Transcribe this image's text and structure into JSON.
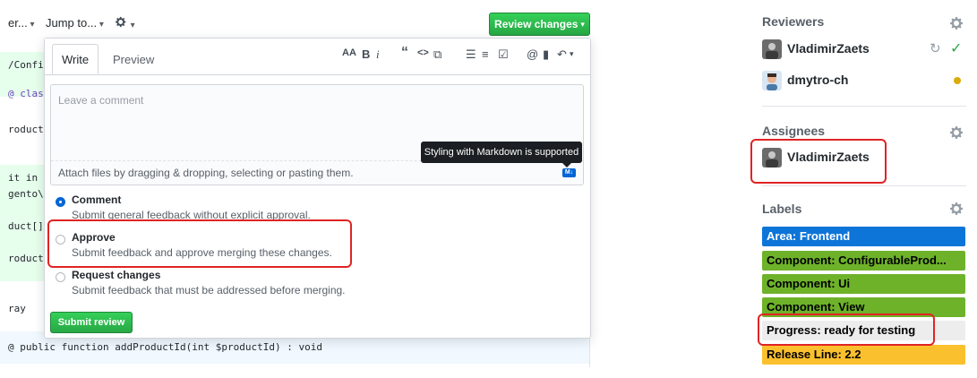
{
  "toolbar": {
    "truncated_item": "er...",
    "jump_to": "Jump to...",
    "review_changes": "Review changes"
  },
  "code": {
    "lines": [
      "/Confi",
      "@ class",
      "roductI",
      "it in",
      "gento\\S",
      "duct[]",
      "roductM",
      "ray",
      "@ public function addProductId(int $productId) : void"
    ]
  },
  "review": {
    "tabs": {
      "write": "Write",
      "preview": "Preview"
    },
    "toolbar_glyphs": {
      "heading": "AA",
      "bold": "B",
      "italic": "i",
      "quote": "“",
      "code": "<>",
      "link": "⧉",
      "ul": "☰",
      "ol": "≡",
      "task": "☑",
      "mention": "@",
      "bookmark": "▮",
      "reply": "↶"
    },
    "comment_placeholder": "Leave a comment",
    "attach_text": "Attach files by dragging & dropping, selecting or pasting them.",
    "tooltip": "Styling with Markdown is supported",
    "md_icon": "M↓",
    "options": [
      {
        "title": "Comment",
        "desc": "Submit general feedback without explicit approval.",
        "checked": true
      },
      {
        "title": "Approve",
        "desc": "Submit feedback and approve merging these changes.",
        "checked": false
      },
      {
        "title": "Request changes",
        "desc": "Submit feedback that must be addressed before merging.",
        "checked": false
      }
    ],
    "submit": "Submit review"
  },
  "sidebar": {
    "reviewers_title": "Reviewers",
    "reviewers": [
      {
        "name": "VladimirZaets",
        "status": "approved"
      },
      {
        "name": "dmytro-ch",
        "status": "pending"
      }
    ],
    "assignees_title": "Assignees",
    "assignees": [
      {
        "name": "VladimirZaets"
      }
    ],
    "labels_title": "Labels",
    "labels": [
      {
        "name": "Area: Frontend",
        "bg": "#0e75d8",
        "fg": "#ffffff"
      },
      {
        "name": "Component: ConfigurableProd...",
        "bg": "#6eb22a",
        "fg": "#000000"
      },
      {
        "name": "Component: Ui",
        "bg": "#6eb22a",
        "fg": "#000000"
      },
      {
        "name": "Component: View",
        "bg": "#6eb22a",
        "fg": "#000000"
      },
      {
        "name": "Progress: ready for testing",
        "bg": "#ededed",
        "fg": "#000000"
      },
      {
        "name": "Release Line: 2.2",
        "bg": "#fbc02d",
        "fg": "#000000"
      }
    ]
  },
  "colors": {
    "accent_green": "#28a745",
    "link_blue": "#0366d6",
    "highlight_red": "#e02424",
    "pending_orange": "#dbab09"
  }
}
